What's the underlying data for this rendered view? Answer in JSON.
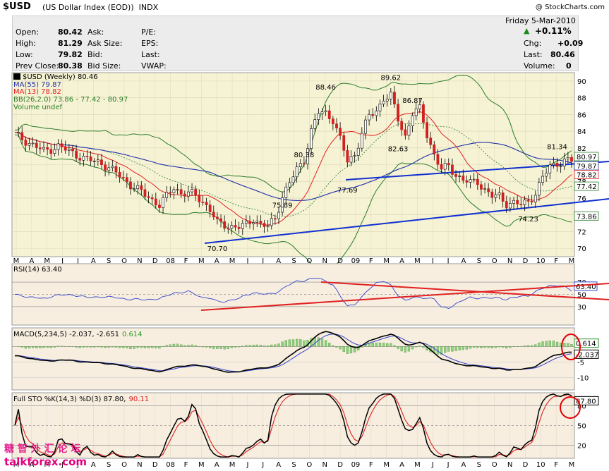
{
  "header": {
    "symbol": "$USD",
    "name": "(US Dollar Index (EOD))",
    "exchange": "INDX",
    "brand": "@ StockCharts.com"
  },
  "quote": {
    "open_label": "Open:",
    "open": "80.42",
    "high_label": "High:",
    "high": "81.29",
    "low_label": "Low:",
    "low": "79.82",
    "prevclose_label": "Prev Close:",
    "prevclose": "80.38",
    "ask_label": "Ask:",
    "asksize_label": "Ask Size:",
    "bid_label": "Bid:",
    "bidsize_label": "Bid Size:",
    "pe_label": "P/E:",
    "eps_label": "EPS:",
    "last_label2": "Last:",
    "vwap_label": "VWAP:",
    "date": "Friday   5-Mar-2010",
    "pct": "+0.11%",
    "chg_label": "Chg:",
    "chg": "+0.09",
    "last_label": "Last:",
    "last": "80.46",
    "vol_label": "Volume:",
    "vol": "0"
  },
  "legend": {
    "price": "$USD (Weekly) 80.46",
    "ma55": "MA(55) 79.87",
    "ma13": "MA(13) 78.82",
    "bb": "BB(26,2.0) 73.86 - 77.42 - 80.97",
    "vol": "Volume undef"
  },
  "rsi_legend": "RSI(14) 63.40",
  "macd_legend": {
    "text": "MACD(5,234,5) -2.037, -2.651",
    "hist": "0.614"
  },
  "sto_legend": {
    "text": "Full STO %K(14,3) %D(3) 87.80,",
    "d": "90.11"
  },
  "watermark": {
    "cn": "糖 智 外 汇 论 坛",
    "site": "talkforex.com"
  },
  "colors": {
    "price_bg": "#f6f3d4",
    "ind_bg": "#f7eee0",
    "ma55": "#1f2fa8",
    "ma13": "#e02020",
    "bb": "#2a7d2a",
    "trend": "#1030d0",
    "red_trend": "#e02020"
  },
  "chart_data": [
    {
      "type": "line",
      "title": "$USD (Weekly) 80.46",
      "x_months": [
        "M",
        "A",
        "M",
        "J",
        "J",
        "A",
        "S",
        "O",
        "N",
        "D",
        "08",
        "F",
        "M",
        "A",
        "M",
        "J",
        "J",
        "A",
        "S",
        "O",
        "N",
        "D",
        "09",
        "F",
        "M",
        "A",
        "M",
        "J",
        "J",
        "A",
        "S",
        "O",
        "N",
        "D",
        "10",
        "F",
        "M"
      ],
      "y_ticks": [
        70,
        72,
        74,
        76,
        78,
        80,
        82,
        84,
        86,
        88,
        90
      ],
      "ylim": [
        69,
        91
      ],
      "price_path": [
        [
          0,
          83.6
        ],
        [
          4,
          82.6
        ],
        [
          8,
          81.6
        ],
        [
          12,
          82.2
        ],
        [
          16,
          81.4
        ],
        [
          20,
          80.6
        ],
        [
          24,
          80.2
        ],
        [
          28,
          79.0
        ],
        [
          32,
          77.6
        ],
        [
          36,
          76.4
        ],
        [
          40,
          75.2
        ],
        [
          42,
          76.2
        ],
        [
          44,
          77.3
        ],
        [
          46,
          76.6
        ],
        [
          48,
          76.6
        ],
        [
          50,
          76.3
        ],
        [
          52,
          75.6
        ],
        [
          54,
          74.6
        ],
        [
          56,
          73.0
        ],
        [
          60,
          72.6
        ],
        [
          62,
          72.5
        ],
        [
          64,
          72.8
        ],
        [
          66,
          73.6
        ],
        [
          68,
          72.8
        ],
        [
          70,
          72.6
        ],
        [
          72,
          73.6
        ],
        [
          74,
          76.2
        ],
        [
          76,
          77.8
        ],
        [
          78,
          79.4
        ],
        [
          80,
          80.6
        ],
        [
          82,
          84.0
        ],
        [
          84,
          86.2
        ],
        [
          86,
          86.2
        ],
        [
          88,
          85.4
        ],
        [
          90,
          83.0
        ],
        [
          92,
          80.4
        ],
        [
          94,
          81.2
        ],
        [
          96,
          83.8
        ],
        [
          98,
          85.8
        ],
        [
          100,
          86.4
        ],
        [
          102,
          88.0
        ],
        [
          104,
          88.2
        ],
        [
          106,
          85.4
        ],
        [
          108,
          83.4
        ],
        [
          110,
          86.2
        ],
        [
          112,
          86.6
        ],
        [
          114,
          83.6
        ],
        [
          116,
          81.2
        ],
        [
          118,
          79.4
        ],
        [
          120,
          79.8
        ],
        [
          122,
          78.8
        ],
        [
          124,
          78.2
        ],
        [
          126,
          77.8
        ],
        [
          128,
          78.0
        ],
        [
          130,
          77.0
        ],
        [
          132,
          76.2
        ],
        [
          134,
          76.2
        ],
        [
          136,
          75.4
        ],
        [
          138,
          75.4
        ],
        [
          140,
          75.2
        ],
        [
          142,
          75.6
        ],
        [
          144,
          76.6
        ],
        [
          146,
          78.4
        ],
        [
          148,
          79.8
        ],
        [
          150,
          80.2
        ],
        [
          152,
          80.4
        ],
        [
          154,
          80.46
        ]
      ],
      "annotations": [
        "70.70",
        "75.89",
        "80.38",
        "77.69",
        "88.46",
        "89.62",
        "82.63",
        "86.87",
        "74.23",
        "81.34"
      ],
      "right_labels": [
        "80.46",
        "79.87",
        "78.82",
        "77.42",
        "73.86",
        "80.97"
      ]
    },
    {
      "type": "line",
      "title": "RSI(14) 63.40",
      "y_ticks": [
        30,
        50,
        70
      ],
      "right_labels": [
        "63.40"
      ]
    },
    {
      "type": "line",
      "title": "MACD(5,234,5) -2.037, -2.651",
      "y_ticks": [
        -10,
        -5
      ],
      "right_labels": [
        "0.614",
        "-2.037"
      ]
    },
    {
      "type": "line",
      "title": "Full STO %K(14,3) %D(3) 87.80, 90.11",
      "y_ticks": [
        20,
        50,
        80
      ],
      "right_labels": [
        "87.80"
      ]
    }
  ]
}
